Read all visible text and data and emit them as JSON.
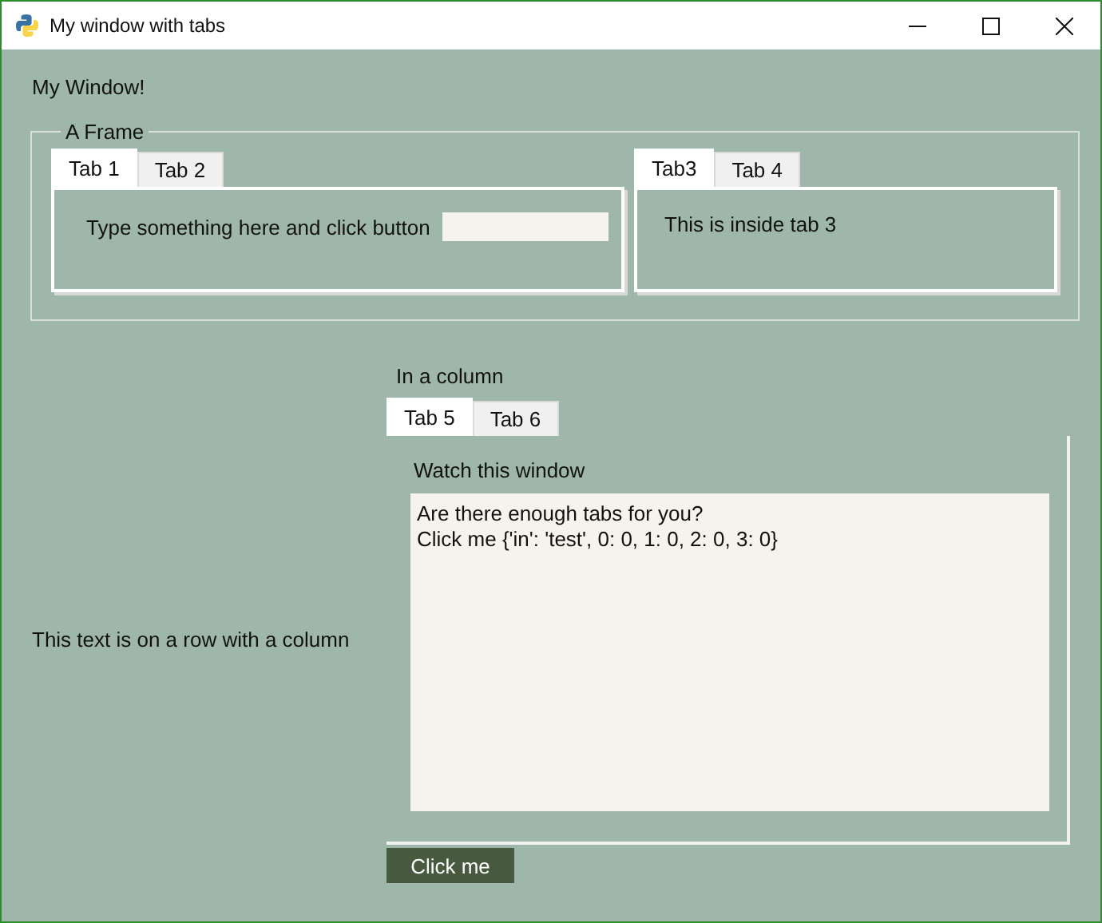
{
  "window": {
    "title": "My window with tabs"
  },
  "heading": "My Window!",
  "frame": {
    "legend": "A Frame",
    "tab_groups": [
      {
        "tabs": [
          {
            "label": "Tab 1",
            "selected": true
          },
          {
            "label": "Tab 2",
            "selected": false
          }
        ],
        "content": {
          "kind": "input",
          "label": "Type something here and click button"
        }
      },
      {
        "tabs": [
          {
            "label": "Tab3",
            "selected": true
          },
          {
            "label": "Tab 4",
            "selected": false
          }
        ],
        "content": {
          "kind": "text",
          "label": "This is inside tab 3"
        }
      }
    ]
  },
  "row": {
    "text": "This text is on a row with a column",
    "column": {
      "title": "In a column",
      "tabs": [
        {
          "label": "Tab 5",
          "selected": true
        },
        {
          "label": "Tab 6",
          "selected": false
        }
      ],
      "panel_label": "Watch this window",
      "output": [
        "Are there enough tabs for you?",
        "Click me {'in': 'test', 0: 0, 1: 0, 2: 0, 3: 0}"
      ],
      "button": "Click me"
    }
  }
}
